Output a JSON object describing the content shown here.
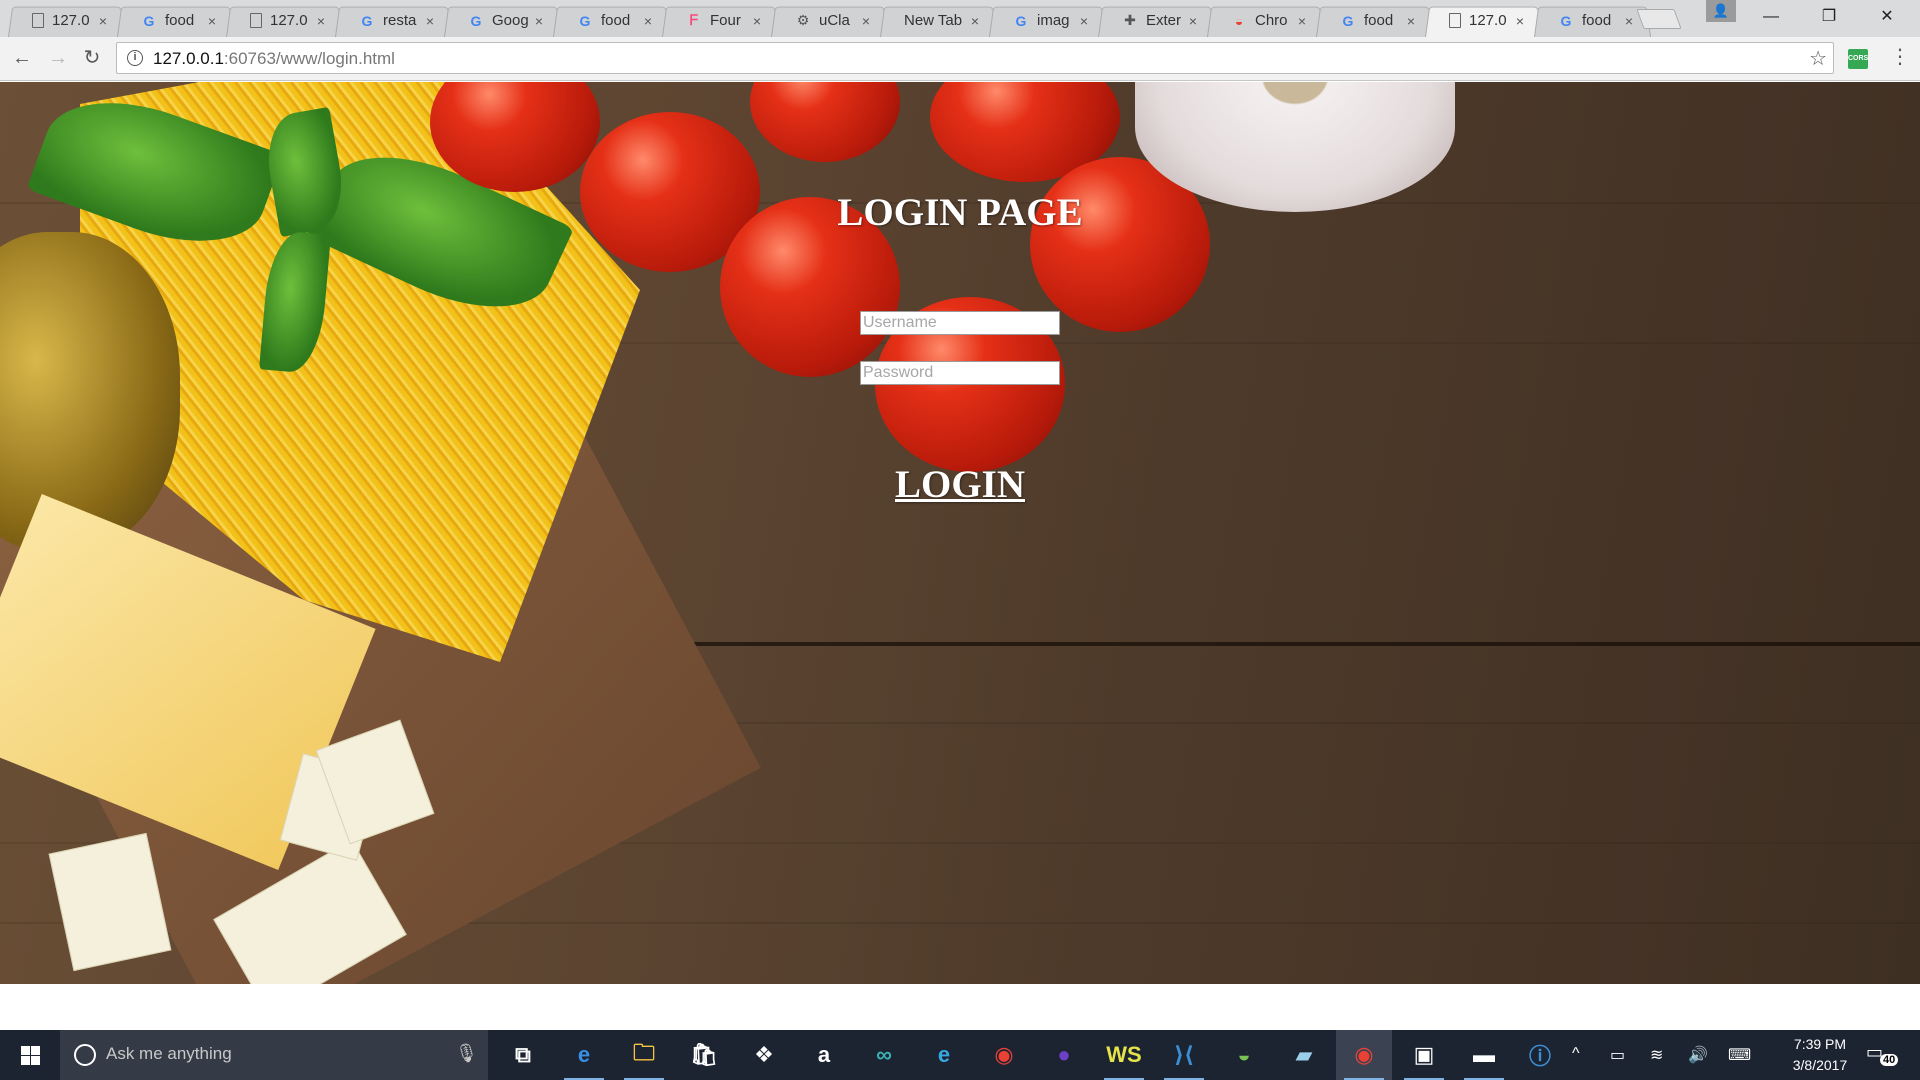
{
  "browser": {
    "tabs": [
      {
        "label": "127.0",
        "favicon": "doc-icon",
        "active": false
      },
      {
        "label": "food",
        "favicon": "google-icon",
        "active": false
      },
      {
        "label": "127.0",
        "favicon": "doc-icon",
        "active": false
      },
      {
        "label": "resta",
        "favicon": "google-icon",
        "active": false
      },
      {
        "label": "Goog",
        "favicon": "google-icon",
        "active": false
      },
      {
        "label": "food",
        "favicon": "google-icon",
        "active": false
      },
      {
        "label": "Four",
        "favicon": "foursquare-icon",
        "active": false
      },
      {
        "label": "uCla",
        "favicon": "gear-icon",
        "active": false
      },
      {
        "label": "New Tab",
        "favicon": "",
        "active": false
      },
      {
        "label": "imag",
        "favicon": "google-icon",
        "active": false
      },
      {
        "label": "Exter",
        "favicon": "puzzle-icon",
        "active": false
      },
      {
        "label": "Chro",
        "favicon": "chrome-icon",
        "active": false
      },
      {
        "label": "food",
        "favicon": "google-icon",
        "active": false
      },
      {
        "label": "127.0",
        "favicon": "doc-icon",
        "active": true
      },
      {
        "label": "food",
        "favicon": "google-icon",
        "active": false
      }
    ],
    "tab_close_glyph": "×",
    "window": {
      "minimize": "—",
      "restore": "❐",
      "close": "✕"
    },
    "nav": {
      "back": "←",
      "forward": "→",
      "reload": "↻"
    },
    "url": {
      "host": "127.0.0.1",
      "path": ":60763/www/login.html"
    },
    "bookmark_glyph": "☆",
    "extension_badge": "CORS",
    "menu_glyph": "⋮",
    "profile_glyph": "👤"
  },
  "page": {
    "title": "LOGIN PAGE",
    "username_placeholder": "Username",
    "password_placeholder": "Password",
    "login_label": "LOGIN"
  },
  "taskbar": {
    "search_placeholder": "Ask me anything",
    "apps": [
      {
        "name": "task-view-icon",
        "glyph": "⧉",
        "running": false
      },
      {
        "name": "edge-icon",
        "glyph": "e",
        "running": true,
        "color": "#3a8ee6"
      },
      {
        "name": "file-explorer-icon",
        "glyph": "🗀",
        "running": true,
        "color": "#f3c443"
      },
      {
        "name": "store-icon",
        "glyph": "🛍",
        "running": false
      },
      {
        "name": "dropbox-icon",
        "glyph": "❖",
        "running": false
      },
      {
        "name": "amazon-icon",
        "glyph": "a",
        "running": false
      },
      {
        "name": "arduino-icon",
        "glyph": "∞",
        "running": false,
        "color": "#3bb3b3"
      },
      {
        "name": "internet-explorer-icon",
        "glyph": "e",
        "running": false,
        "color": "#36a9e1"
      },
      {
        "name": "chrome-app-icon",
        "glyph": "◉",
        "running": false,
        "color": "#e94235"
      },
      {
        "name": "github-icon",
        "glyph": "●",
        "running": false,
        "color": "#6e40c9"
      },
      {
        "name": "webstorm-icon",
        "glyph": "WS",
        "running": true,
        "color": "#e4e44a"
      },
      {
        "name": "vscode-icon",
        "glyph": "⟩⟨",
        "running": true,
        "color": "#3b8fd6"
      },
      {
        "name": "android-studio-icon",
        "glyph": "◒",
        "running": false,
        "color": "#78c257"
      },
      {
        "name": "notepad-icon",
        "glyph": "▰",
        "running": false,
        "color": "#9ad0ea"
      },
      {
        "name": "chrome-active-icon",
        "glyph": "◉",
        "running": true,
        "active": true,
        "color": "#e94235"
      },
      {
        "name": "window-app-icon",
        "glyph": "▣",
        "running": true
      },
      {
        "name": "terminal-icon",
        "glyph": "▬",
        "running": true
      },
      {
        "name": "notification-app-icon",
        "glyph": "ⓘ",
        "running": false,
        "color": "#3b8fd6"
      }
    ],
    "tray": {
      "chevron": "^",
      "battery": "▭",
      "wifi": "≋",
      "volume": "🔊",
      "keyboard": "⌨"
    },
    "time": "7:39 PM",
    "date": "3/8/2017",
    "notification_count": "40"
  }
}
